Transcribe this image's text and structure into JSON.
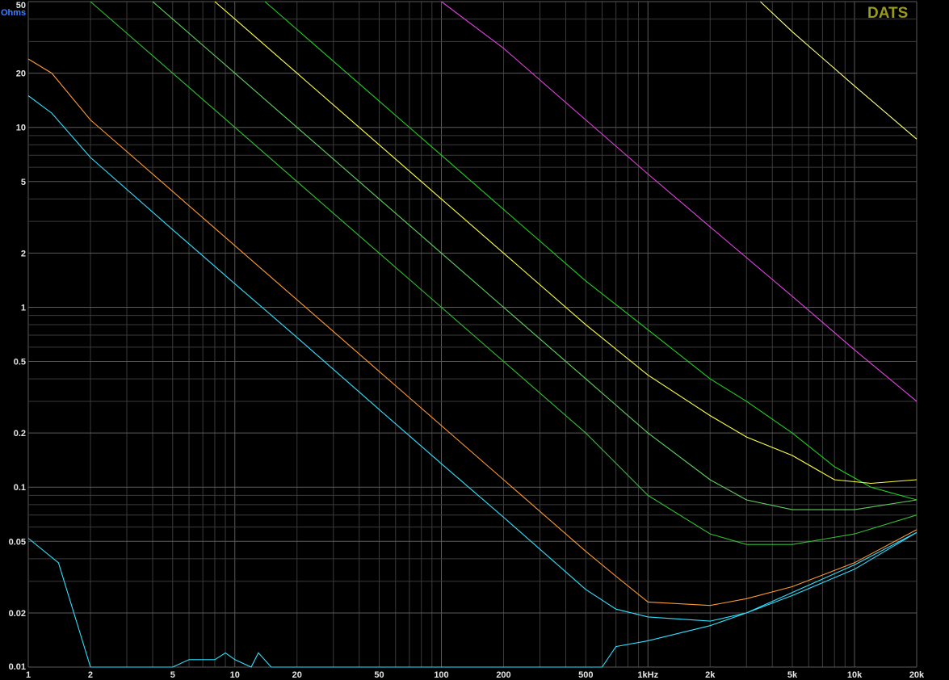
{
  "chart_data": {
    "type": "line",
    "title": "",
    "xlabel": "",
    "ylabel": "Ohms",
    "brand": "DATS",
    "x_scale": "log",
    "y_scale": "log",
    "xlim": [
      1,
      20000
    ],
    "ylim": [
      0.01,
      50
    ],
    "grid": true,
    "x_ticks": [
      "1",
      "2",
      "5",
      "10",
      "20",
      "50",
      "100",
      "200",
      "500",
      "1kHz",
      "2k",
      "5k",
      "10k",
      "20k"
    ],
    "y_ticks": [
      "50",
      "20",
      "10",
      "5",
      "2",
      "1",
      "0.5",
      "0.2",
      "0.1",
      "0.05",
      "0.02",
      "0.01"
    ],
    "series": [
      {
        "color": "#ffff80",
        "points": [
          [
            3500,
            50
          ],
          [
            5000,
            34
          ],
          [
            10000,
            17
          ],
          [
            20000,
            8.6
          ]
        ]
      },
      {
        "color": "#e040e0",
        "points": [
          [
            100,
            50
          ],
          [
            200,
            27.5
          ],
          [
            500,
            11
          ],
          [
            1000,
            5.5
          ],
          [
            2000,
            2.8
          ],
          [
            5000,
            1.15
          ],
          [
            10000,
            0.58
          ],
          [
            20000,
            0.3
          ],
          [
            1000,
            5.5
          ]
        ]
      },
      {
        "color": "#20d020",
        "points": [
          [
            14,
            50
          ],
          [
            20,
            35
          ],
          [
            50,
            14
          ],
          [
            100,
            7
          ],
          [
            200,
            3.5
          ],
          [
            500,
            1.4
          ],
          [
            1000,
            0.75
          ],
          [
            2000,
            0.4
          ],
          [
            3000,
            0.3
          ],
          [
            5000,
            0.2
          ],
          [
            8000,
            0.13
          ],
          [
            12000,
            0.1
          ],
          [
            20000,
            0.085
          ]
        ]
      },
      {
        "color": "#ffff40",
        "points": [
          [
            8,
            50
          ],
          [
            10,
            40
          ],
          [
            20,
            20
          ],
          [
            50,
            8
          ],
          [
            100,
            4
          ],
          [
            200,
            2
          ],
          [
            500,
            0.8
          ],
          [
            1000,
            0.42
          ],
          [
            2000,
            0.25
          ],
          [
            3000,
            0.19
          ],
          [
            5000,
            0.15
          ],
          [
            8000,
            0.11
          ],
          [
            12000,
            0.105
          ],
          [
            20000,
            0.11
          ]
        ]
      },
      {
        "color": "#60d060",
        "points": [
          [
            4,
            50
          ],
          [
            5,
            40
          ],
          [
            10,
            20
          ],
          [
            20,
            10
          ],
          [
            50,
            4
          ],
          [
            100,
            2
          ],
          [
            200,
            1
          ],
          [
            500,
            0.4
          ],
          [
            1000,
            0.2
          ],
          [
            2000,
            0.11
          ],
          [
            3000,
            0.085
          ],
          [
            5000,
            0.075
          ],
          [
            10000,
            0.075
          ],
          [
            20000,
            0.085
          ]
        ]
      },
      {
        "color": "#30c030",
        "points": [
          [
            2,
            50
          ],
          [
            5,
            20
          ],
          [
            10,
            10
          ],
          [
            20,
            5
          ],
          [
            50,
            2
          ],
          [
            100,
            1
          ],
          [
            200,
            0.5
          ],
          [
            500,
            0.2
          ],
          [
            1000,
            0.09
          ],
          [
            2000,
            0.055
          ],
          [
            3000,
            0.048
          ],
          [
            5000,
            0.048
          ],
          [
            10000,
            0.055
          ],
          [
            20000,
            0.07
          ]
        ]
      },
      {
        "color": "#ff9a30",
        "points": [
          [
            1,
            24
          ],
          [
            1.3,
            20
          ],
          [
            2,
            11
          ],
          [
            5,
            4.4
          ],
          [
            10,
            2.2
          ],
          [
            20,
            1.1
          ],
          [
            50,
            0.44
          ],
          [
            100,
            0.22
          ],
          [
            200,
            0.11
          ],
          [
            500,
            0.044
          ],
          [
            700,
            0.032
          ],
          [
            1000,
            0.023
          ],
          [
            2000,
            0.022
          ],
          [
            3000,
            0.024
          ],
          [
            5000,
            0.028
          ],
          [
            10000,
            0.038
          ],
          [
            20000,
            0.058
          ]
        ]
      },
      {
        "color": "#30e0ff",
        "points": [
          [
            1,
            15
          ],
          [
            1.3,
            12
          ],
          [
            2,
            6.8
          ],
          [
            5,
            2.7
          ],
          [
            10,
            1.35
          ],
          [
            20,
            0.68
          ],
          [
            50,
            0.27
          ],
          [
            100,
            0.135
          ],
          [
            200,
            0.068
          ],
          [
            500,
            0.027
          ],
          [
            700,
            0.021
          ],
          [
            1000,
            0.019
          ],
          [
            2000,
            0.018
          ],
          [
            3000,
            0.02
          ],
          [
            5000,
            0.026
          ],
          [
            10000,
            0.037
          ],
          [
            20000,
            0.056
          ]
        ]
      },
      {
        "color": "#30e0ff",
        "points": [
          [
            1,
            0.052
          ],
          [
            1.4,
            0.038
          ],
          [
            2,
            0.01
          ],
          [
            5,
            0.01
          ],
          [
            6,
            0.011
          ],
          [
            8,
            0.011
          ],
          [
            9,
            0.012
          ],
          [
            10,
            0.011
          ],
          [
            12,
            0.01
          ],
          [
            13,
            0.012
          ],
          [
            15,
            0.01
          ],
          [
            600,
            0.01
          ],
          [
            700,
            0.013
          ],
          [
            1000,
            0.014
          ],
          [
            2000,
            0.017
          ],
          [
            3000,
            0.02
          ],
          [
            5000,
            0.025
          ],
          [
            10000,
            0.035
          ],
          [
            20000,
            0.056
          ]
        ]
      }
    ]
  }
}
